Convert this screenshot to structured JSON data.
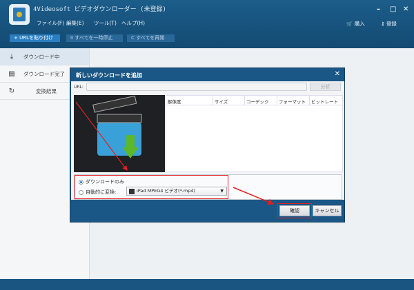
{
  "app": {
    "title": "4Videosoft ビデオダウンローダー (未登録)",
    "menu": [
      "ファイル(F)",
      "編集(E)",
      "ツール(T)",
      "ヘルプ(H)"
    ],
    "buy": "購入",
    "register": "登録"
  },
  "toolbar": {
    "paste_url": "+ URLを貼り付け",
    "pause_all": "II すべてを一時停止",
    "resume_all": "C すべてを再開"
  },
  "sidebar": {
    "items": [
      {
        "label": "ダウンロード中",
        "icon": "download-icon"
      },
      {
        "label": "ダウンロード完了",
        "icon": "file-done-icon"
      },
      {
        "label": "変換結果",
        "icon": "convert-icon"
      }
    ]
  },
  "dialog": {
    "title": "新しいダウンロードを追加",
    "url_label": "URL:",
    "url_value": "",
    "analyze": "分析",
    "columns": [
      "解像度",
      "サイズ",
      "コーデック",
      "フォーマット",
      "ビットレート"
    ],
    "download_only": "ダウンロードのみ",
    "auto_convert": "自動的に変換:",
    "format": "iPad MPEG4 ビデオ(*.mp4)",
    "selected_option": "download_only",
    "ok": "確認",
    "cancel": "キャンセル"
  },
  "annotation_color": "#e02020"
}
